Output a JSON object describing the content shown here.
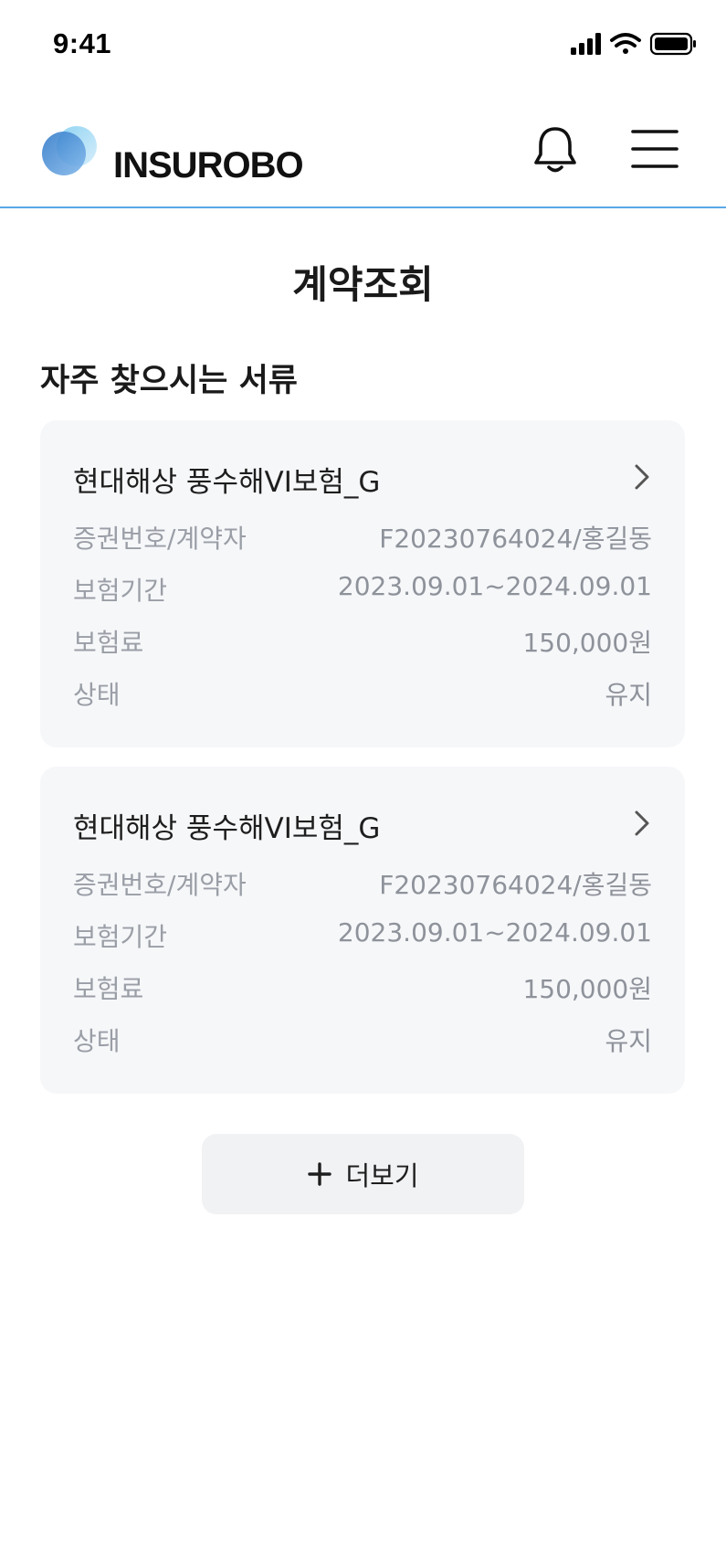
{
  "status_bar": {
    "time": "9:41",
    "icons": [
      "signal-icon",
      "wifi-icon",
      "battery-icon"
    ]
  },
  "header": {
    "brand": "INSUROBO",
    "icons": [
      "notification-bell-icon",
      "hamburger-menu-icon"
    ],
    "accent_color": "#5aa9e6"
  },
  "page": {
    "title": "계약조회",
    "section_title": "자주 찾으시는 서류"
  },
  "contracts": [
    {
      "name": "현대해상 풍수해VI보험_G",
      "rows": [
        {
          "label": "증권번호/계약자",
          "value": "F20230764024/홍길동"
        },
        {
          "label": "보험기간",
          "value": "2023.09.01~2024.09.01"
        },
        {
          "label": "보험료",
          "value": "150,000원"
        },
        {
          "label": "상태",
          "value": "유지"
        }
      ]
    },
    {
      "name": "현대해상 풍수해VI보험_G",
      "rows": [
        {
          "label": "증권번호/계약자",
          "value": "F20230764024/홍길동"
        },
        {
          "label": "보험기간",
          "value": "2023.09.01~2024.09.01"
        },
        {
          "label": "보험료",
          "value": "150,000원"
        },
        {
          "label": "상태",
          "value": "유지"
        }
      ]
    }
  ],
  "more_button": {
    "label": "더보기",
    "icon": "plus-icon"
  }
}
